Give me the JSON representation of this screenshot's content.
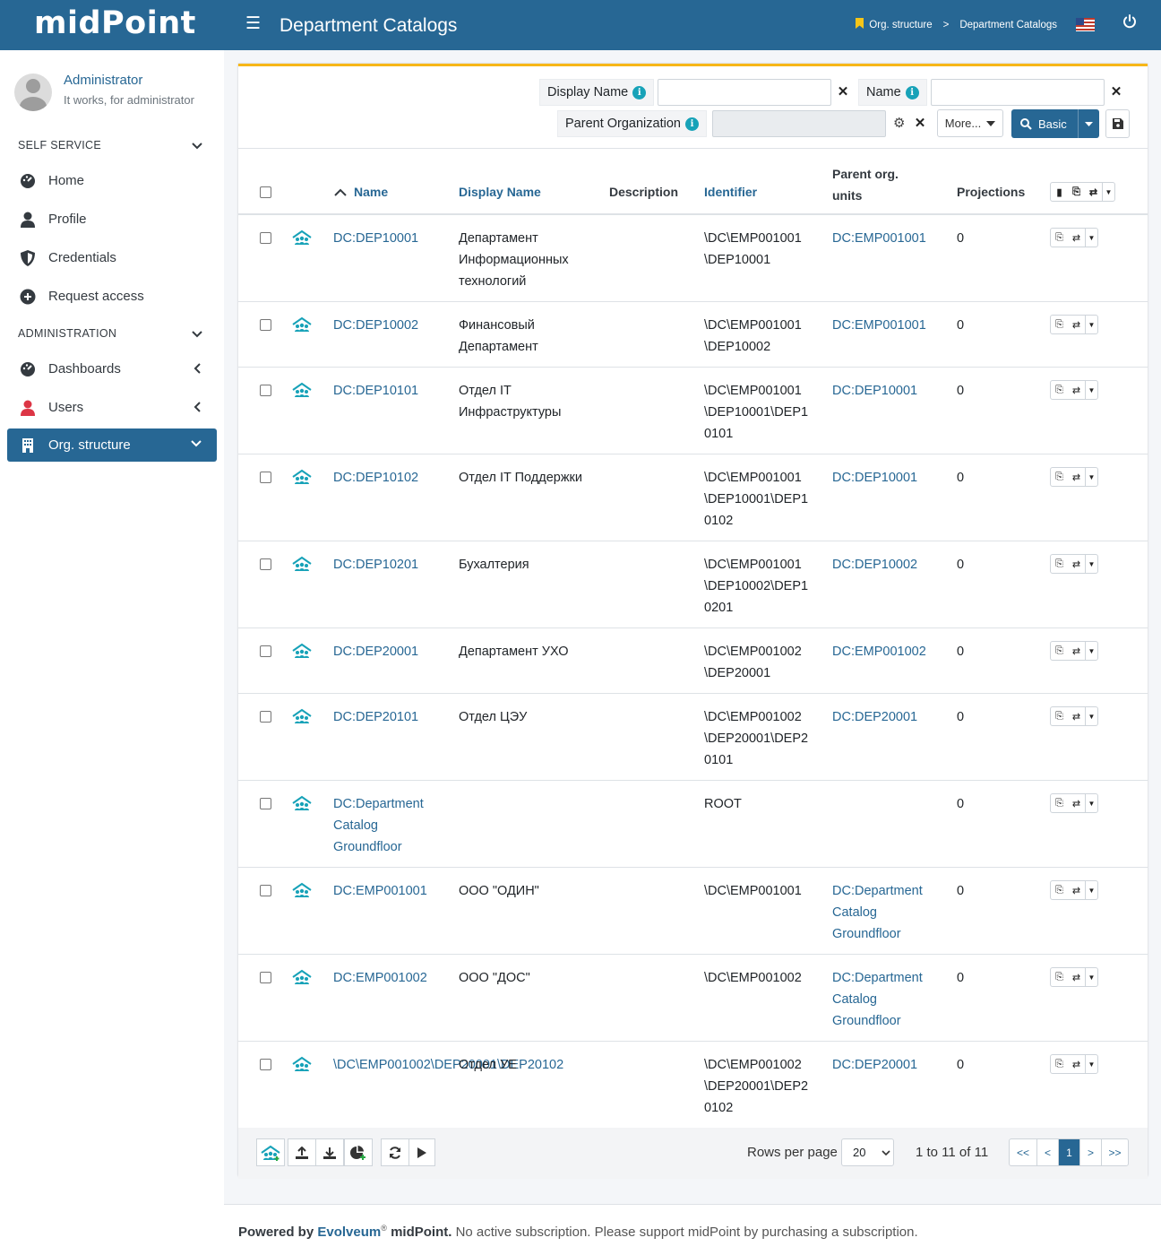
{
  "app": {
    "logo": "midPoint",
    "page_title": "Department Catalogs"
  },
  "breadcrumb": {
    "items": [
      "Org. structure",
      "Department Catalogs"
    ],
    "separator": ">"
  },
  "user": {
    "name": "Administrator",
    "subtitle": "It works, for administrator"
  },
  "sidebar": {
    "sections": [
      {
        "label": "SELF SERVICE"
      },
      {
        "label": "ADMINISTRATION"
      }
    ],
    "items": [
      {
        "label": "Home",
        "icon": "dashboard-icon"
      },
      {
        "label": "Profile",
        "icon": "user-icon"
      },
      {
        "label": "Credentials",
        "icon": "shield-icon"
      },
      {
        "label": "Request access",
        "icon": "plus-circle-icon"
      },
      {
        "label": "Dashboards",
        "icon": "dashboard-icon"
      },
      {
        "label": "Users",
        "icon": "user-icon"
      },
      {
        "label": "Org. structure",
        "icon": "building-icon"
      }
    ]
  },
  "search": {
    "display_name_label": "Display Name",
    "display_name_value": "",
    "name_label": "Name",
    "name_value": "",
    "parent_org_label": "Parent Organization",
    "parent_org_value": "",
    "more_label": "More...",
    "basic_label": "Basic"
  },
  "table": {
    "columns": {
      "name": "Name",
      "display_name": "Display Name",
      "description": "Description",
      "identifier": "Identifier",
      "parent": "Parent org. units",
      "projections": "Projections"
    },
    "rows": [
      {
        "name": "DC:DEP10001",
        "display_name": "Департамент Информационных технологий",
        "description": "",
        "identifier": "\\DC\\EMP001001\\DEP10001",
        "parent": "DC:EMP001001",
        "projections": "0"
      },
      {
        "name": "DC:DEP10002",
        "display_name": "Финансовый Департамент",
        "description": "",
        "identifier": "\\DC\\EMP001001\\DEP10002",
        "parent": "DC:EMP001001",
        "projections": "0"
      },
      {
        "name": "DC:DEP10101",
        "display_name": "Отдел IT Инфраструктуры",
        "description": "",
        "identifier": "\\DC\\EMP001001\\DEP10001\\DEP10101",
        "parent": "DC:DEP10001",
        "projections": "0"
      },
      {
        "name": "DC:DEP10102",
        "display_name": "Отдел IT Поддержки",
        "description": "",
        "identifier": "\\DC\\EMP001001\\DEP10001\\DEP10102",
        "parent": "DC:DEP10001",
        "projections": "0"
      },
      {
        "name": "DC:DEP10201",
        "display_name": "Бухалтерия",
        "description": "",
        "identifier": "\\DC\\EMP001001\\DEP10002\\DEP10201",
        "parent": "DC:DEP10002",
        "projections": "0"
      },
      {
        "name": "DC:DEP20001",
        "display_name": "Департамент УХО",
        "description": "",
        "identifier": "\\DC\\EMP001002\\DEP20001",
        "parent": "DC:EMP001002",
        "projections": "0"
      },
      {
        "name": "DC:DEP20101",
        "display_name": "Отдел ЦЭУ",
        "description": "",
        "identifier": "\\DC\\EMP001002\\DEP20001\\DEP20101",
        "parent": "DC:DEP20001",
        "projections": "0"
      },
      {
        "name": "DC:Department Catalog Groundfloor",
        "display_name": "",
        "description": "",
        "identifier": "ROOT",
        "parent": "",
        "projections": "0"
      },
      {
        "name": "DC:EMP001001",
        "display_name": "ООО \"ОДИН\"",
        "description": "",
        "identifier": "\\DC\\EMP001001",
        "parent": "DC:Department Catalog Groundfloor",
        "projections": "0"
      },
      {
        "name": "DC:EMP001002",
        "display_name": "ООО \"ДОС\"",
        "description": "",
        "identifier": "\\DC\\EMP001002",
        "parent": "DC:Department Catalog Groundfloor",
        "projections": "0"
      },
      {
        "name": "\\DC\\EMP001002\\DEP20001\\DEP20102",
        "display_name": "Отдел УЕ",
        "description": "",
        "identifier": "\\DC\\EMP001002\\DEP20001\\DEP20102",
        "parent": "DC:DEP20001",
        "projections": "0"
      }
    ]
  },
  "pagination": {
    "rows_per_page_label": "Rows per page",
    "rows_per_page_value": "20",
    "count_text": "1 to 11 of 11",
    "first": "<<",
    "prev": "<",
    "current": "1",
    "next": ">",
    "last": ">>"
  },
  "footer": {
    "powered_by": "Powered by",
    "brand": "Evolveum",
    "reg": "®",
    "product": "midPoint.",
    "message": "No active subscription. Please support midPoint by purchasing a subscription."
  },
  "colors": {
    "brand": "#276794",
    "accent": "#f7b718",
    "org_icon": "#17a2b8"
  }
}
